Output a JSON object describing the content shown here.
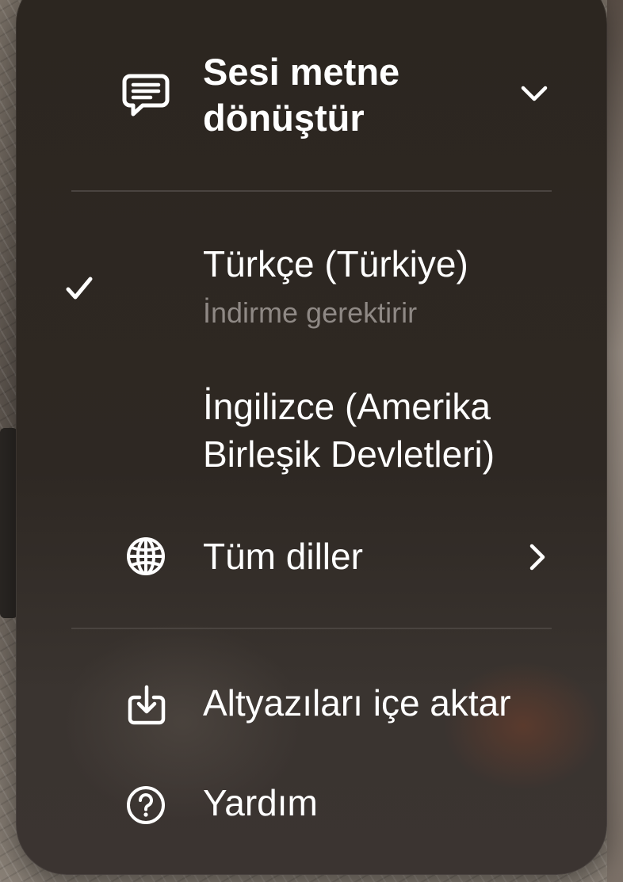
{
  "menu": {
    "header": {
      "title_line1": "Sesi metne",
      "title_line2": "dönüştür",
      "icon": "transcript-bubble-icon",
      "chevron": "chevron-down-icon"
    },
    "languages": [
      {
        "label": "Türkçe (Türkiye)",
        "subtitle": "İndirme gerektirir",
        "selected": true
      },
      {
        "label_line1": "İngilizce (Amerika",
        "label_line2": "Birleşik Devletleri)",
        "selected": false
      }
    ],
    "all_languages": {
      "label": "Tüm diller",
      "icon": "globe-icon",
      "chevron": "chevron-right-icon"
    },
    "import_subtitles": {
      "label": "Altyazıları içe aktar",
      "icon": "import-icon"
    },
    "help": {
      "label": "Yardım",
      "icon": "help-circle-icon"
    },
    "colors": {
      "text": "#ffffff",
      "subtitle": "#8f8985",
      "divider": "#4a4440",
      "background": "#2e2823"
    }
  }
}
